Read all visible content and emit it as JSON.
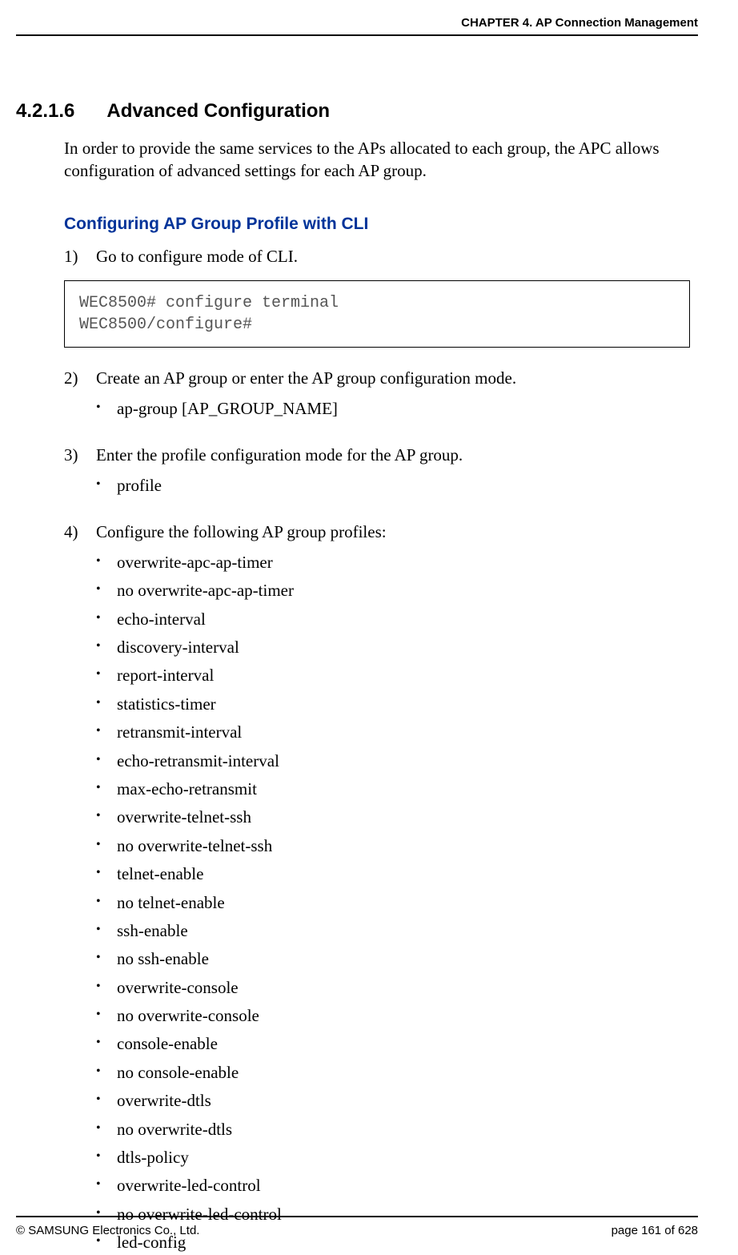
{
  "header": {
    "chapter": "CHAPTER 4. AP Connection Management"
  },
  "section": {
    "number": "4.2.1.6",
    "title": "Advanced Configuration",
    "intro": "In order to provide the same services to the APs allocated to each group, the APC allows configuration of advanced settings for each AP group."
  },
  "subheading": "Configuring AP Group Profile with CLI",
  "steps": {
    "s1": {
      "num": "1)",
      "text": "Go to configure mode of CLI."
    },
    "code": "WEC8500# configure terminal \nWEC8500/configure#  ",
    "s2": {
      "num": "2)",
      "text": "Create an AP group or enter the AP group configuration mode.",
      "bullets": [
        "ap-group [AP_GROUP_NAME]"
      ]
    },
    "s3": {
      "num": "3)",
      "text": "Enter the profile configuration mode for the AP group.",
      "bullets": [
        "profile"
      ]
    },
    "s4": {
      "num": "4)",
      "text": "Configure the following AP group profiles:",
      "bullets": [
        "overwrite-apc-ap-timer",
        "no overwrite-apc-ap-timer",
        "echo-interval",
        "discovery-interval",
        "report-interval",
        "statistics-timer",
        "retransmit-interval",
        "echo-retransmit-interval",
        "max-echo-retransmit",
        "overwrite-telnet-ssh",
        "no overwrite-telnet-ssh",
        "telnet-enable",
        "no telnet-enable",
        "ssh-enable",
        "no ssh-enable",
        "overwrite-console",
        "no overwrite-console",
        "console-enable",
        "no console-enable",
        "overwrite-dtls",
        "no overwrite-dtls",
        "dtls-policy",
        "overwrite-led-control",
        "no overwrite-led-control",
        "led-config"
      ]
    }
  },
  "footer": {
    "copyright": "© SAMSUNG Electronics Co., Ltd.",
    "page": "page 161 of 628"
  }
}
